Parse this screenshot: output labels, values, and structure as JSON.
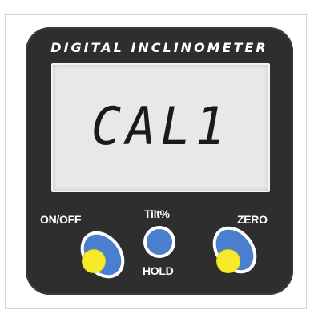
{
  "device": {
    "title": "DIGITAL INCLINOMETER",
    "display_text": "CAL1"
  },
  "buttons": {
    "power_label": "ON/OFF",
    "tilt_label": "Tilt%",
    "hold_label": "HOLD",
    "zero_label": "ZERO"
  },
  "colors": {
    "body": "#2f2e2f",
    "button_blue": "#4a7fd0",
    "indicator_yellow": "#f6ea2b",
    "lcd_background": "#e8e8e8"
  }
}
